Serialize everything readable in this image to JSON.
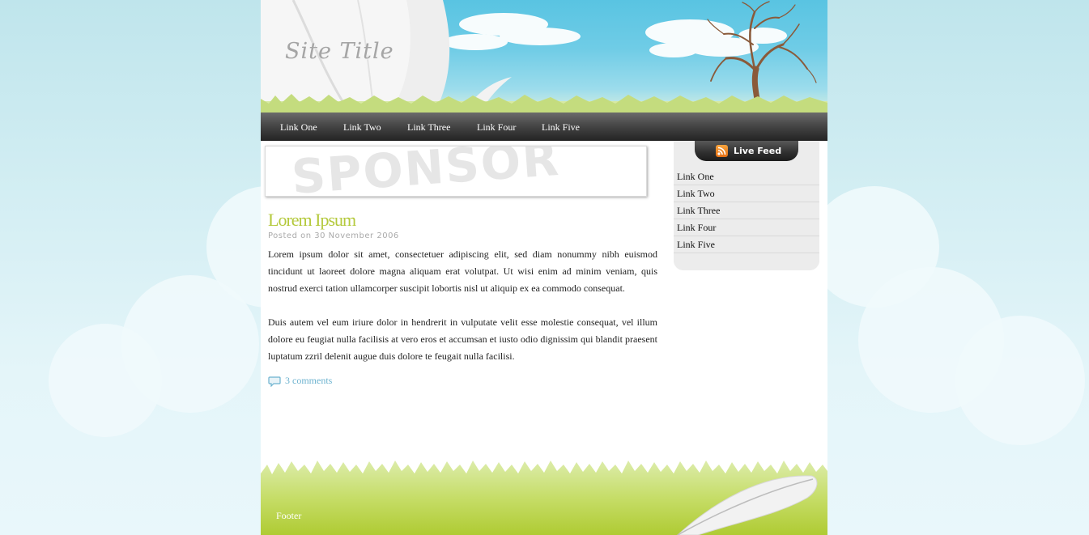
{
  "site": {
    "title": "Site Title"
  },
  "nav": {
    "items": [
      {
        "label": "Link One"
      },
      {
        "label": "Link Two"
      },
      {
        "label": "Link Three"
      },
      {
        "label": "Link Four"
      },
      {
        "label": "Link Five"
      }
    ]
  },
  "sponsor": {
    "text": "SPONSOR"
  },
  "post": {
    "title": "Lorem Ipsum",
    "meta": "Posted on 30 November 2006",
    "paragraphs": [
      "Lorem ipsum dolor sit amet, consectetuer adipiscing elit, sed diam nonummy nibh euismod tincidunt ut laoreet dolore magna aliquam erat volutpat. Ut wisi enim ad minim veniam, quis nostrud exerci tation ullamcorper suscipit lobortis nisl ut aliquip ex ea commodo consequat.",
      "Duis autem vel eum iriure dolor in hendrerit in vulputate velit esse molestie consequat, vel illum dolore eu feugiat nulla facilisis at vero eros et accumsan et iusto odio dignissim qui blandit praesent luptatum zzril delenit augue duis dolore te feugait nulla facilisi."
    ],
    "comments": "3 comments"
  },
  "sidebar": {
    "feed_label": "Live Feed",
    "items": [
      {
        "label": "Link One"
      },
      {
        "label": "Link Two"
      },
      {
        "label": "Link Three"
      },
      {
        "label": "Link Four"
      },
      {
        "label": "Link Five"
      }
    ]
  },
  "footer": {
    "label": "Footer"
  },
  "icons": {
    "rss": "rss-feed-icon",
    "comment": "speech-bubble-icon"
  },
  "colors": {
    "sky": "#5cc6e3",
    "post_title": "#b4c93c",
    "link": "#6cb2cf",
    "grass": "#b3cf3a",
    "nav_dark": "#2e2e2e"
  }
}
